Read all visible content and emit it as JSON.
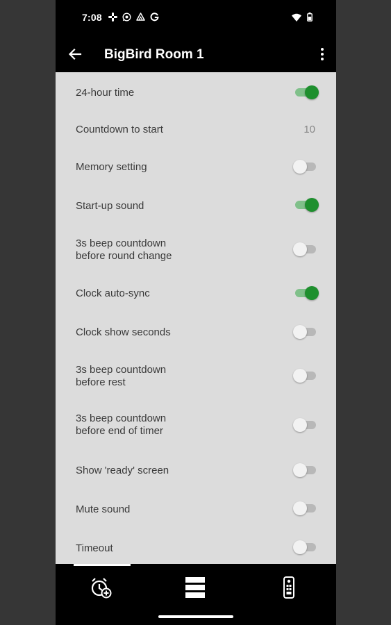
{
  "status_bar": {
    "time": "7:08",
    "notification_icons": [
      "slack-icon",
      "whatsapp-icon",
      "drive-icon",
      "google-icon"
    ],
    "system_icons": [
      "wifi-icon",
      "battery-icon"
    ]
  },
  "app_bar": {
    "title": "BigBird Room 1",
    "back_icon": "arrow-left-icon",
    "menu_icon": "more-vert-icon"
  },
  "settings": [
    {
      "label": "24-hour time",
      "type": "switch",
      "on": true
    },
    {
      "label": "Countdown to start",
      "type": "value",
      "value": "10"
    },
    {
      "label": "Memory setting",
      "type": "switch",
      "on": false
    },
    {
      "label": "Start-up sound",
      "type": "switch",
      "on": true
    },
    {
      "label": "3s beep countdown\nbefore round change",
      "type": "switch",
      "on": false
    },
    {
      "label": "Clock auto-sync",
      "type": "switch",
      "on": true
    },
    {
      "label": "Clock show seconds",
      "type": "switch",
      "on": false
    },
    {
      "label": "3s beep countdown\nbefore rest",
      "type": "switch",
      "on": false
    },
    {
      "label": "3s beep countdown\nbefore end of timer",
      "type": "switch",
      "on": false
    },
    {
      "label": "Show 'ready' screen",
      "type": "switch",
      "on": false
    },
    {
      "label": "Mute sound",
      "type": "switch",
      "on": false
    },
    {
      "label": "Timeout",
      "type": "switch",
      "on": false
    }
  ],
  "bottom_nav": {
    "items": [
      {
        "icon": "add-timer-icon",
        "selected": true
      },
      {
        "icon": "list-icon",
        "selected": false
      },
      {
        "icon": "remote-icon",
        "selected": false
      }
    ]
  },
  "colors": {
    "switch_on": "#1e8f2e",
    "switch_on_track": "#80c08a",
    "content_bg": "#dcdcdc",
    "bars_bg": "#000000"
  }
}
